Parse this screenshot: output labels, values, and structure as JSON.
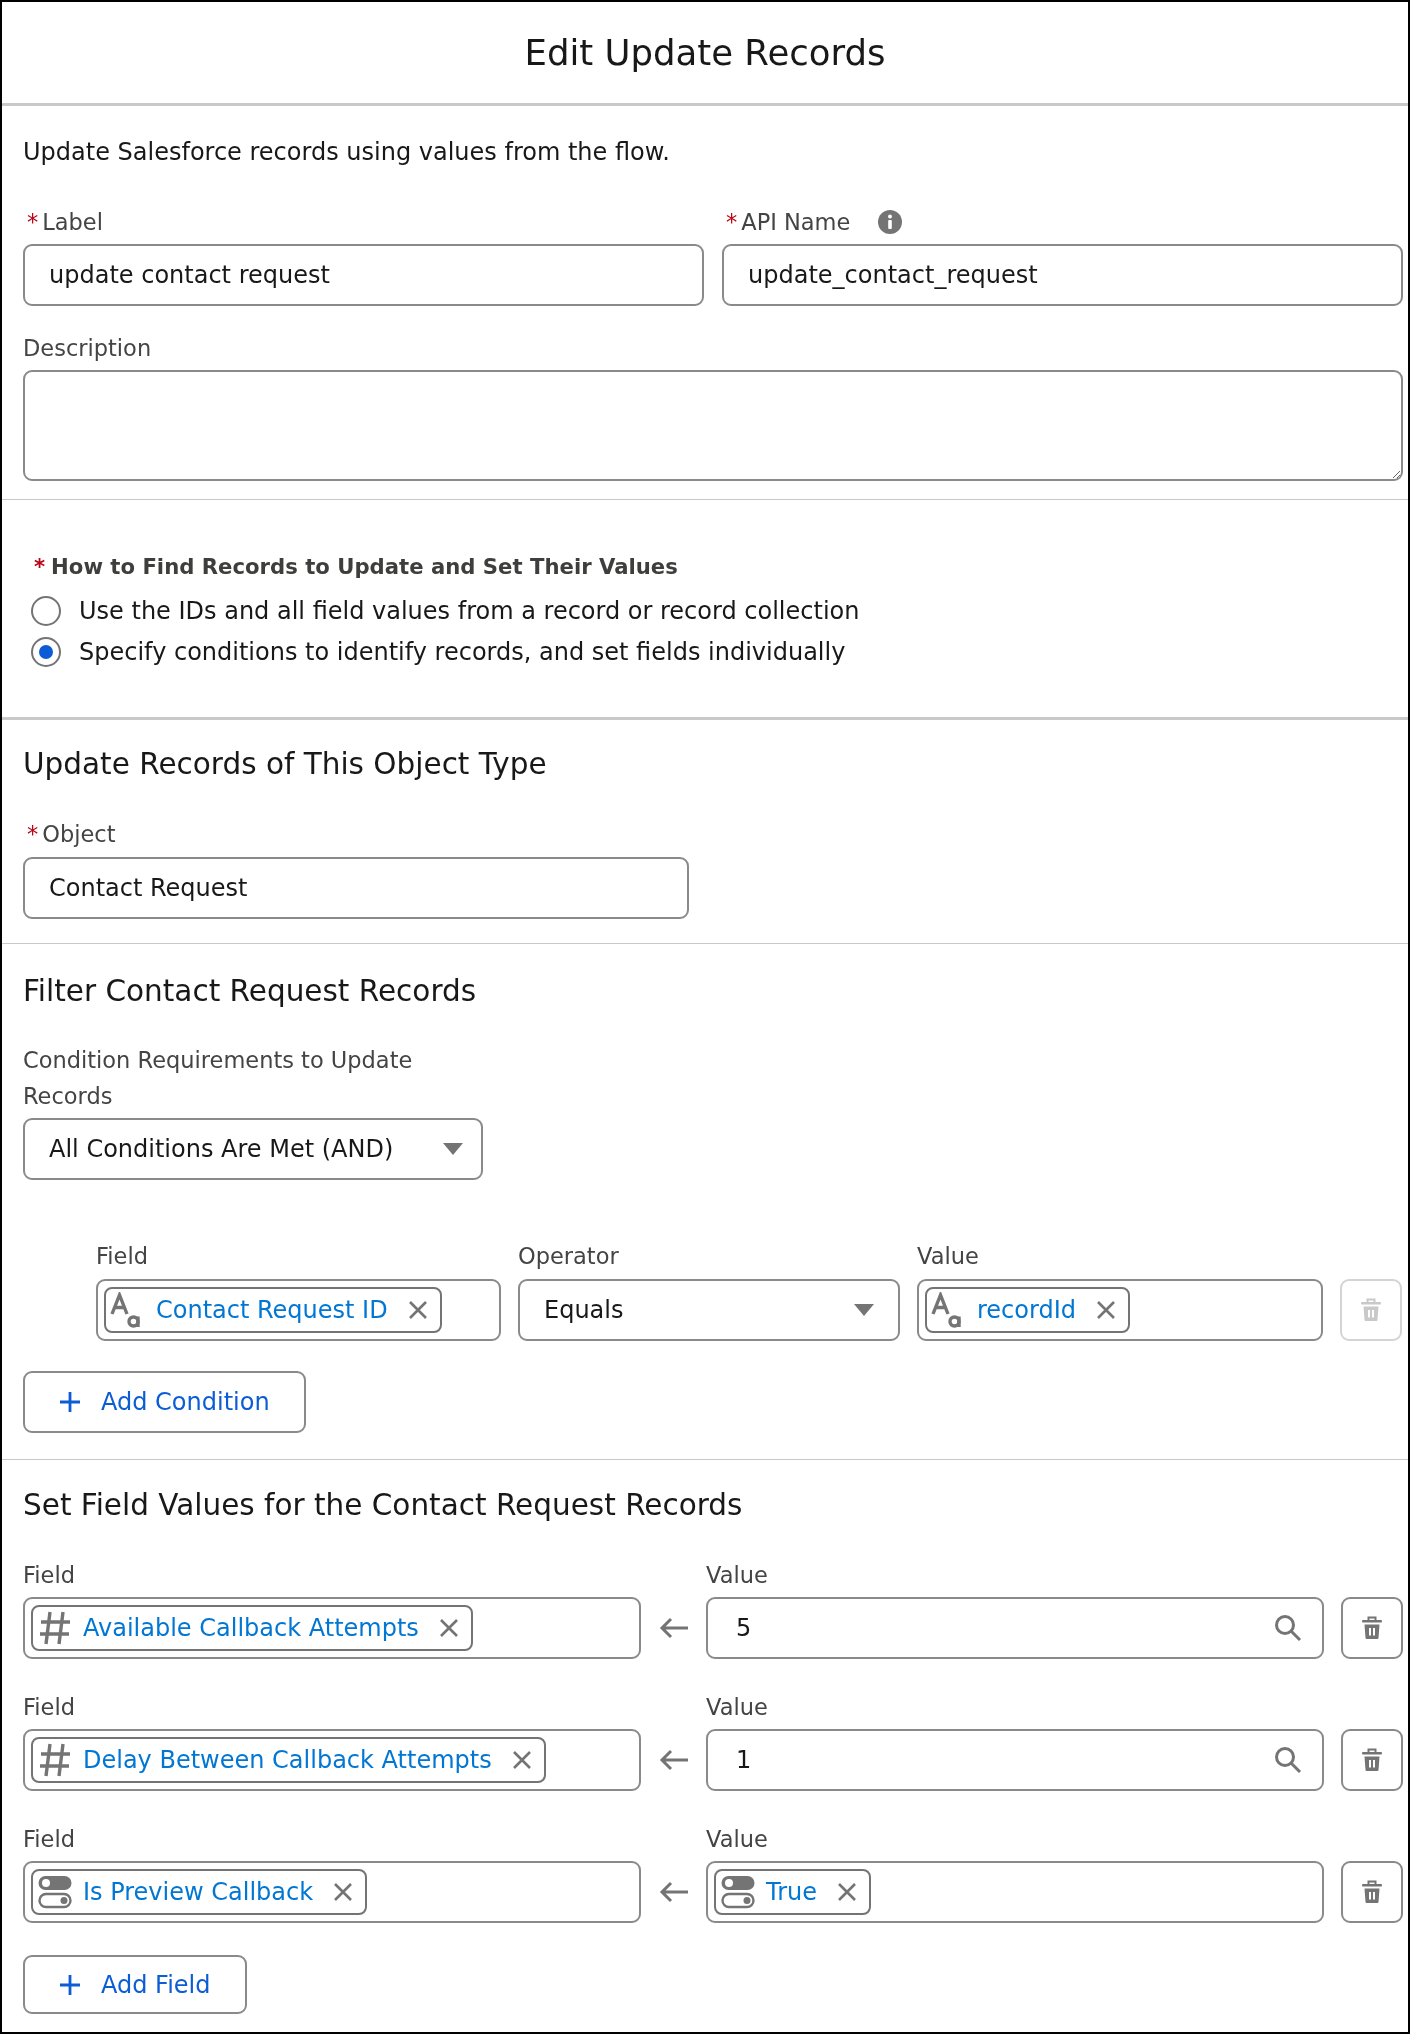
{
  "dialog": {
    "title": "Edit Update Records"
  },
  "intro": "Update Salesforce records using values from the flow.",
  "label_field": {
    "required_mark": "*",
    "label": "Label",
    "value": "update contact request"
  },
  "api_name_field": {
    "required_mark": "*",
    "label": "API Name",
    "value": "update_contact_request"
  },
  "description_field": {
    "label": "Description"
  },
  "find_method": {
    "required_mark": "*",
    "label": "How to Find Records to Update and Set Their Values",
    "options": [
      {
        "label": "Use the IDs and all field values from a record or record collection",
        "selected": false
      },
      {
        "label": "Specify conditions to identify records, and set fields individually",
        "selected": true
      }
    ]
  },
  "object_section": {
    "title": "Update Records of This Object Type",
    "object_field": {
      "required_mark": "*",
      "label": "Object",
      "value": "Contact Request"
    }
  },
  "filter_section": {
    "title": "Filter Contact Request Records",
    "requirement_field": {
      "label": "Condition Requirements to Update Records",
      "value": "All Conditions Are Met (AND)"
    },
    "conditions": [
      {
        "field_label": "Field",
        "field": {
          "kind": "text",
          "text": "Contact Request ID"
        },
        "operator_label": "Operator",
        "operator": "Equals",
        "value_label": "Value",
        "value": {
          "kind": "text",
          "text": "recordId"
        },
        "delete_disabled": true
      }
    ],
    "add_button": "Add Condition"
  },
  "assignment_section": {
    "title": "Set Field Values for the Contact Request Records",
    "rows": [
      {
        "field_label": "Field",
        "field": {
          "kind": "number",
          "text": "Available Callback Attempts"
        },
        "value_label": "Value",
        "value": {
          "kind": "literal",
          "text": "5"
        },
        "delete_disabled": false
      },
      {
        "field_label": "Field",
        "field": {
          "kind": "number",
          "text": "Delay Between Callback Attempts"
        },
        "value_label": "Value",
        "value": {
          "kind": "literal",
          "text": "1"
        },
        "delete_disabled": false
      },
      {
        "field_label": "Field",
        "field": {
          "kind": "boolean",
          "text": "Is Preview Callback"
        },
        "value_label": "Value",
        "value": {
          "kind": "boolean",
          "text": "True"
        },
        "delete_disabled": false
      }
    ],
    "add_button": "Add Field"
  }
}
